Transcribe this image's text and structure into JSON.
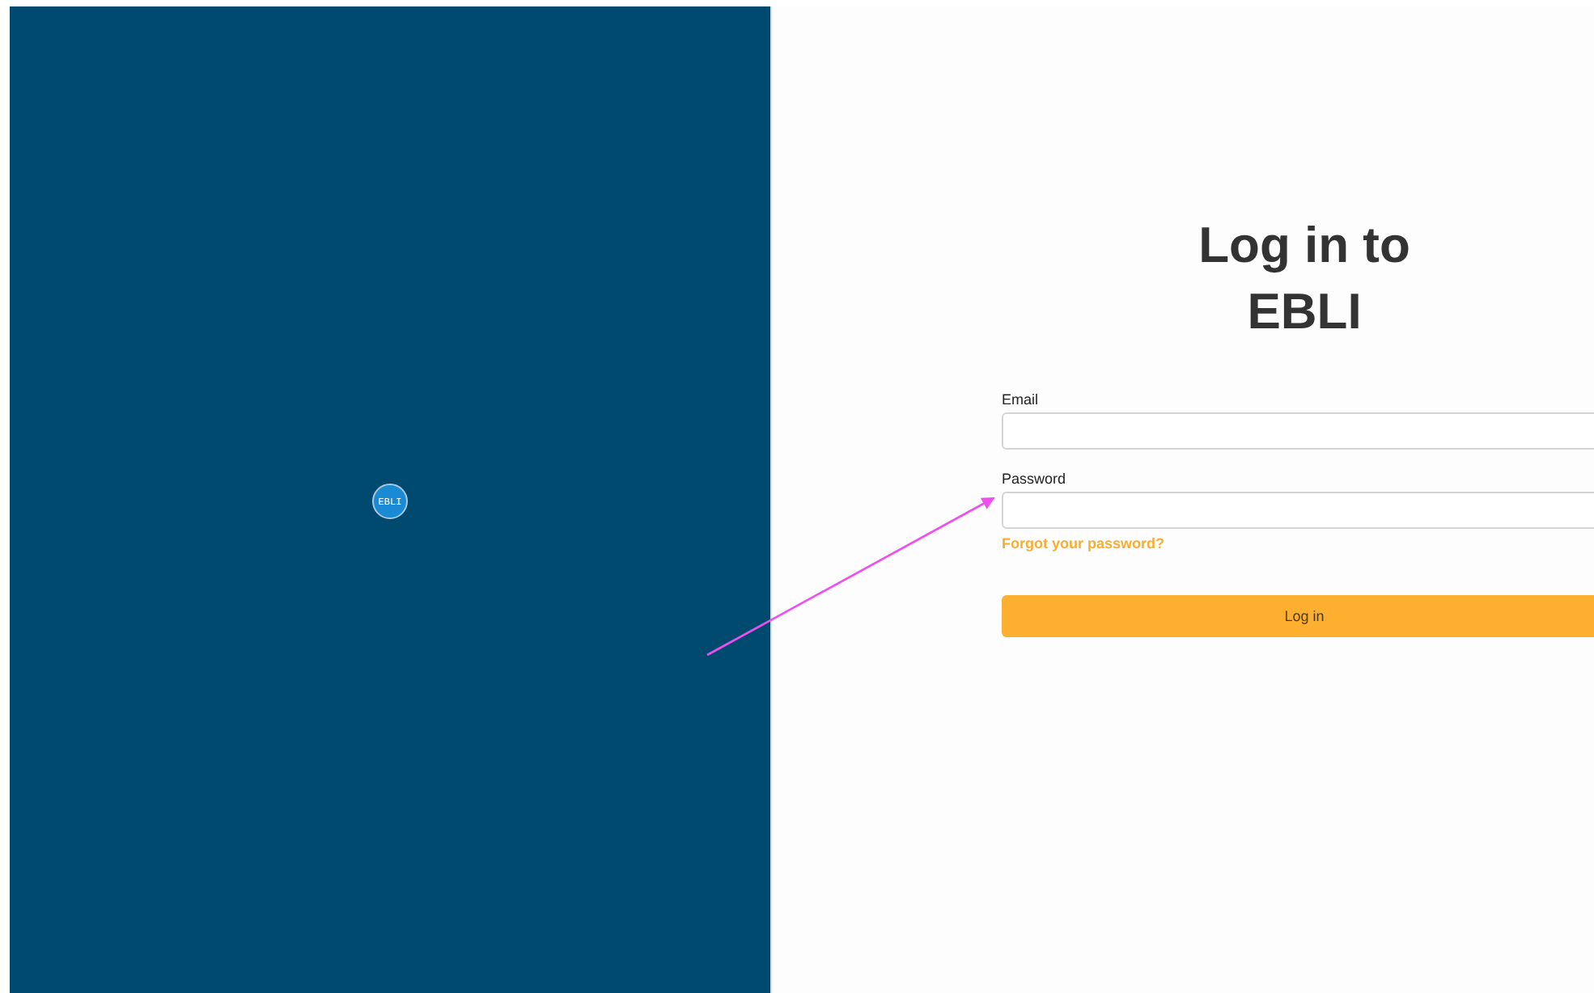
{
  "brand_panel": {
    "logo": "EBLI"
  },
  "login_form": {
    "title_lines": [
      "Log in to",
      "EBLI"
    ],
    "fields": [
      {
        "label": "Email"
      },
      {
        "label": "Password"
      }
    ],
    "forgot_link": "Forgot your password?",
    "submit": "Log in"
  }
}
